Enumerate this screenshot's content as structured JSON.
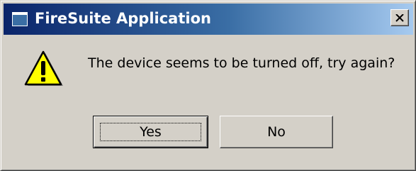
{
  "window": {
    "title": "FireSuite Application",
    "close_icon": "close-icon",
    "app_icon": "window-icon"
  },
  "dialog": {
    "icon": "warning-icon",
    "message": "The device seems to be turned off, try again?"
  },
  "buttons": {
    "yes_label": "Yes",
    "no_label": "No",
    "default": "Yes"
  },
  "colors": {
    "titlebar_start": "#0a246a",
    "titlebar_end": "#a6caf0",
    "face": "#d4d0c8",
    "warning_fill": "#ffff00"
  }
}
